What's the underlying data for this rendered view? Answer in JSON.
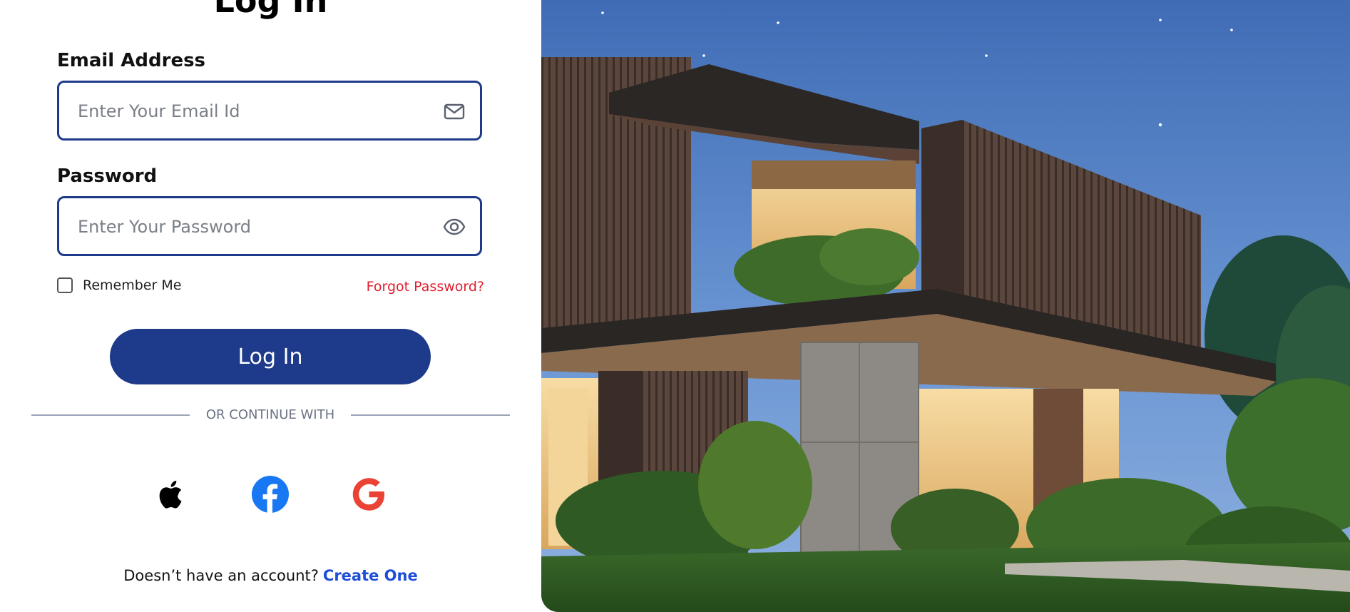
{
  "page": {
    "title": "Log In"
  },
  "email": {
    "label": "Email Address",
    "placeholder": "Enter Your Email Id",
    "icon": "mail-icon"
  },
  "password": {
    "label": "Password",
    "placeholder": "Enter Your Password",
    "icon": "eye-icon"
  },
  "remember": {
    "label": "Remember Me",
    "checked": false
  },
  "forgot": {
    "label": "Forgot Password?"
  },
  "login_button": {
    "label": "Log In"
  },
  "divider": {
    "label": "OR CONTINUE WITH"
  },
  "social": [
    {
      "name": "apple",
      "icon": "apple-icon"
    },
    {
      "name": "facebook",
      "icon": "facebook-icon"
    },
    {
      "name": "google",
      "icon": "google-icon"
    }
  ],
  "signup": {
    "prompt": "Doesn’t have an account?",
    "link": "Create One"
  },
  "colors": {
    "primary": "#1e3a8a",
    "accent_red": "#e11d2e",
    "link_blue": "#1d4ed8",
    "facebook": "#1877f2",
    "google": "#ea4335"
  }
}
